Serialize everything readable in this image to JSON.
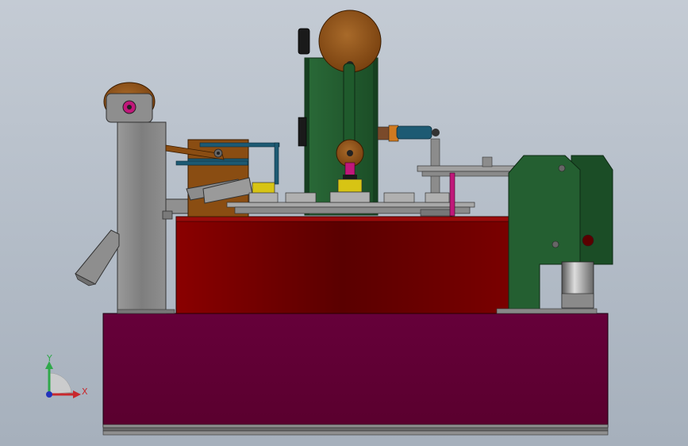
{
  "view": {
    "background_top": "#c4cbd4",
    "background_bottom": "#a6b0bc"
  },
  "triad": {
    "x_label": "X",
    "y_label": "Y",
    "x_color": "#c8282d",
    "y_color": "#2fa84a",
    "z_color": "#2233bb"
  },
  "colors": {
    "base_cabinet": "#5e0030",
    "table_top": "#7a0000",
    "frame_green": "#1f5a2c",
    "gray_steel": "#8a8a8a",
    "bronze_wheel": "#8a4d12",
    "blue_rail": "#1d5a73",
    "yellow_cup": "#d7c414",
    "magenta_rod": "#c0187a"
  }
}
